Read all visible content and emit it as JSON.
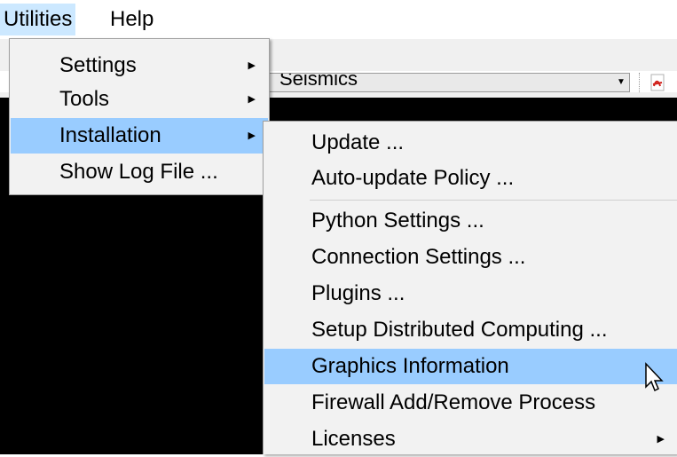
{
  "menubar": {
    "items": [
      {
        "label": "Utilities",
        "active": true
      },
      {
        "label": "Help",
        "active": false
      }
    ]
  },
  "toolbar": {
    "combo_value": "Seismics",
    "pdf_icon": "pdf-icon"
  },
  "main_menu": {
    "items": [
      {
        "label": "Settings",
        "has_submenu": true
      },
      {
        "label": "Tools",
        "has_submenu": true
      },
      {
        "label": "Installation",
        "has_submenu": true,
        "highlighted": true
      },
      {
        "label": "Show Log File ...",
        "has_submenu": false
      }
    ]
  },
  "installation_submenu": {
    "items": [
      {
        "label": "Update ..."
      },
      {
        "label": "Auto-update Policy ..."
      },
      {
        "label": "Python Settings ..."
      },
      {
        "label": "Connection Settings ..."
      },
      {
        "label": "Plugins ..."
      },
      {
        "label": "Setup Distributed Computing ..."
      },
      {
        "label": "Graphics Information",
        "highlighted": true
      },
      {
        "label": "Firewall Add/Remove Process"
      },
      {
        "label": "Licenses",
        "has_submenu": true
      }
    ]
  },
  "colors": {
    "highlight": "#99ccff",
    "menubar_active": "#cce8ff",
    "menu_bg": "#f2f2f2"
  }
}
